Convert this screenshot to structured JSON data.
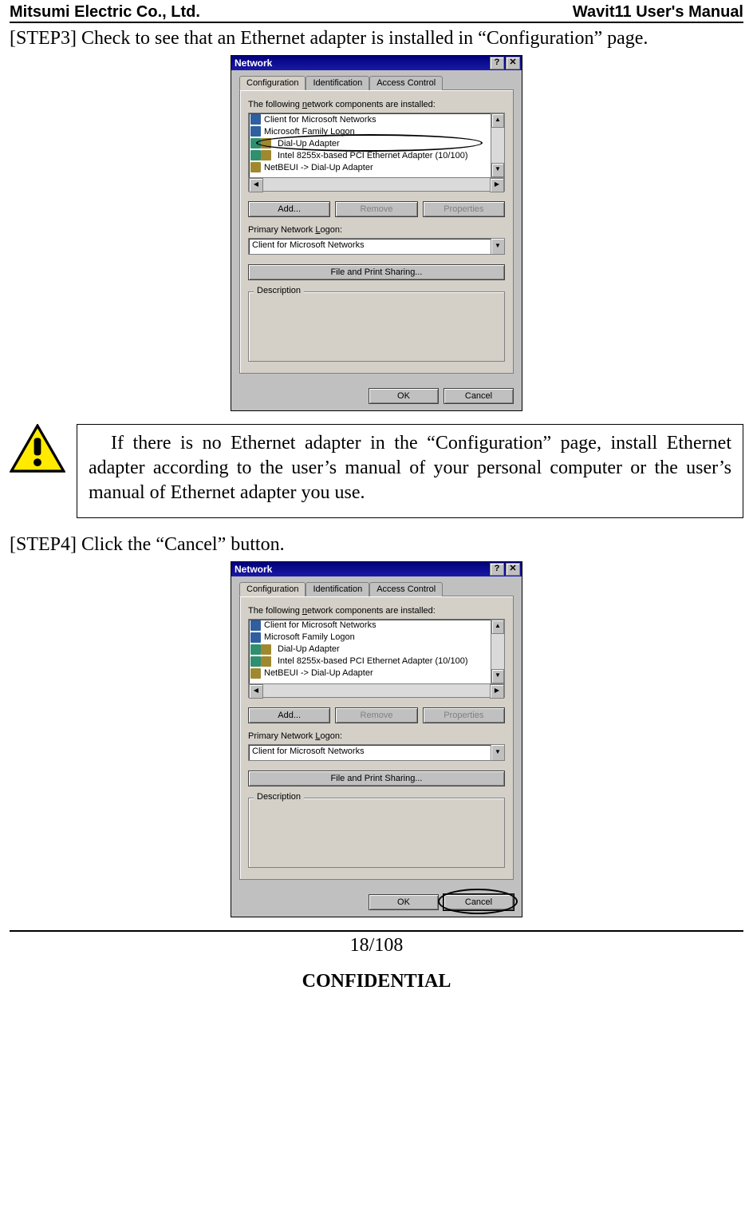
{
  "header": {
    "left": "Mitsumi Electric Co., Ltd.",
    "right": "Wavit11 User's Manual"
  },
  "step3_text": "[STEP3] Check to see that an Ethernet adapter is installed in “Configuration” page.",
  "step4_text": "[STEP4] Click the “Cancel” button.",
  "note_text": "If there is no Ethernet adapter in the “Configuration” page, install Ethernet adapter according to the user’s manual of your personal computer or the user’s manual of Ethernet adapter you use.",
  "dialog": {
    "title": "Network",
    "tabs": [
      "Configuration",
      "Identification",
      "Access Control"
    ],
    "components_label_prefix": "The following ",
    "components_label_underline": "n",
    "components_label_suffix": "etwork components are installed:",
    "items": [
      "Client for Microsoft Networks",
      "Microsoft Family Logon",
      "Dial-Up Adapter",
      "Intel 8255x-based PCI Ethernet Adapter (10/100)",
      "NetBEUI -> Dial-Up Adapter"
    ],
    "add_u": "A",
    "add_label": "dd...",
    "remove_prefix": "R",
    "remove_u": "e",
    "remove_suffix": "move",
    "properties_prefix": "P",
    "properties_u": "r",
    "properties_suffix": "operties",
    "logon_label_prefix": "Primary Network ",
    "logon_label_u": "L",
    "logon_label_suffix": "ogon:",
    "logon_value": "Client for Microsoft Networks",
    "share_u": "F",
    "share_label": "ile and Print Sharing...",
    "desc_label": "Description",
    "ok": "OK",
    "cancel": "Cancel",
    "help_glyph": "?",
    "close_glyph": "✕",
    "up_glyph": "▲",
    "down_glyph": "▼",
    "left_glyph": "◀",
    "right_glyph": "▶"
  },
  "footer": {
    "page": "18/108",
    "conf": "CONFIDENTIAL"
  }
}
